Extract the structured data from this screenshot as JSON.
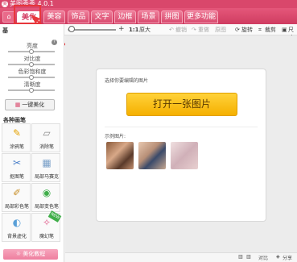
{
  "window": {
    "title": "美图秀秀 4.0.1"
  },
  "tabs": [
    {
      "label": "美化",
      "active": true
    },
    {
      "label": "美容"
    },
    {
      "label": "饰品"
    },
    {
      "label": "文字"
    },
    {
      "label": "边框"
    },
    {
      "label": "场景"
    },
    {
      "label": "拼图"
    },
    {
      "label": "更多功能"
    }
  ],
  "toolbar": {
    "ratio_label": "1:1",
    "zoom_label": "原大",
    "undo_label": "撤销",
    "redo_label": "重做",
    "original_label": "原图",
    "rotate_label": "旋转",
    "crop_label": "裁剪",
    "resize_label": "尺寸"
  },
  "left_panel": {
    "basic_tab": "基",
    "adjustments": [
      {
        "label": "亮度",
        "level": 0.5
      },
      {
        "label": "对比度",
        "level": 0.5
      },
      {
        "label": "色彩饱和度",
        "level": 0.5
      },
      {
        "label": "清晰度",
        "level": 0.5
      }
    ],
    "auto_beautify": "一键美化",
    "section_title": "各种画笔",
    "tools": [
      {
        "label": "涂鸦笔",
        "icon": "doodle-pen-icon"
      },
      {
        "label": "消除笔",
        "icon": "eraser-pen-icon"
      },
      {
        "label": "抠图笔",
        "icon": "cutout-pen-icon"
      },
      {
        "label": "局部马赛克",
        "icon": "mosaic-icon"
      },
      {
        "label": "局部彩色笔",
        "icon": "color-brush-icon"
      },
      {
        "label": "局部变色笔",
        "icon": "recolor-brush-icon"
      },
      {
        "label": "背景虚化",
        "icon": "bg-blur-icon"
      },
      {
        "label": "魔幻笔",
        "icon": "magic-pen-icon"
      }
    ],
    "beauty_button": "美化教程"
  },
  "main": {
    "prompt": "选择你要编辑的图片",
    "open_button": "打开一张图片",
    "example_label": "示例图片:"
  },
  "statusbar": {
    "compare_label": "对比",
    "share_label": "分享"
  },
  "colors": {
    "brand": "#d9476b",
    "highlight": "#e8363b",
    "open_button": "#f5b000"
  }
}
